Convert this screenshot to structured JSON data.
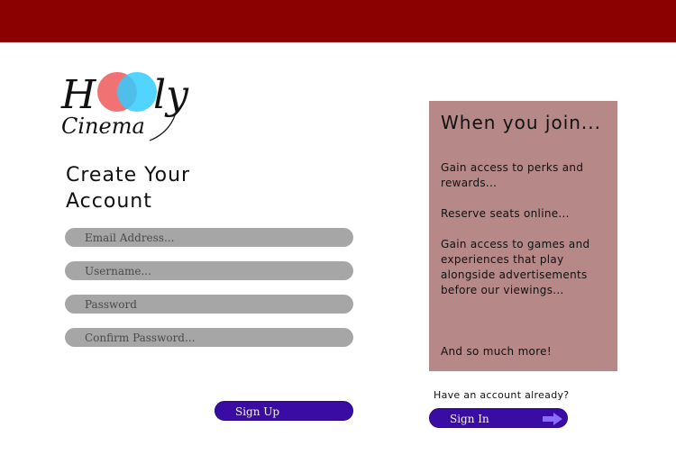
{
  "header": {
    "bar_color": "#8b0000"
  },
  "logo": {
    "text_left": "H",
    "text_right": "ly",
    "subtitle": "Cinema",
    "circle_colors": [
      "#f06a6a",
      "#33ccff"
    ]
  },
  "form": {
    "title": "Create Your Account",
    "fields": [
      {
        "placeholder": "Email Address..."
      },
      {
        "placeholder": "Username..."
      },
      {
        "placeholder": "Password"
      },
      {
        "placeholder": "Confirm Password..."
      }
    ],
    "signup_label": "Sign Up"
  },
  "panel": {
    "title": "When you join...",
    "perks": [
      "Gain access to perks and rewards...",
      "Reserve seats online...",
      "Gain access to games and experiences that play alongside advertisements before our viewings...",
      "And so much more!"
    ],
    "bg_color": "#b68888"
  },
  "signin": {
    "prompt": "Have an account already?",
    "label": "Sign In",
    "icon": "arrow-right-icon"
  },
  "accent": "#3a0ca3"
}
